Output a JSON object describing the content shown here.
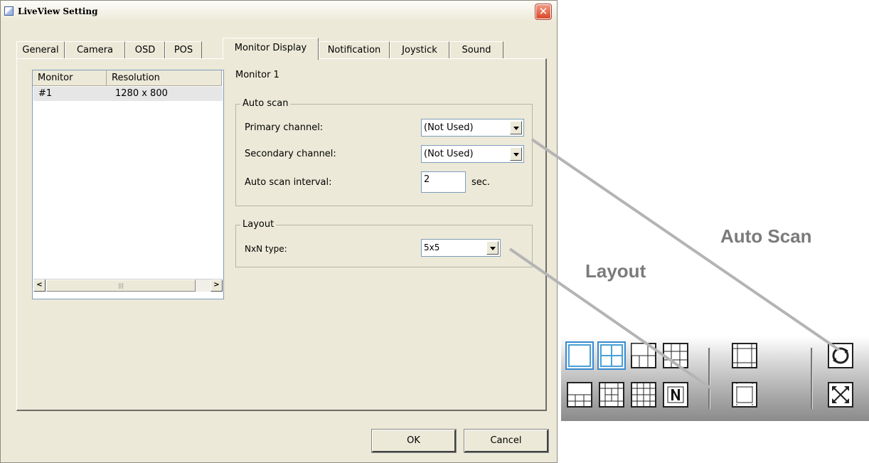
{
  "window": {
    "title": "LiveView Setting"
  },
  "tabs": [
    {
      "label": "General"
    },
    {
      "label": "Camera"
    },
    {
      "label": "OSD"
    },
    {
      "label": "POS"
    },
    {
      "label": "Monitor Display",
      "active": true
    },
    {
      "label": "Notification"
    },
    {
      "label": "Joystick"
    },
    {
      "label": "Sound"
    }
  ],
  "monitor_list": {
    "columns": [
      "Monitor",
      "Resolution"
    ],
    "rows": [
      {
        "monitor": "#1",
        "resolution": "1280 x 800"
      }
    ]
  },
  "monitor_panel": {
    "heading": "Monitor 1",
    "auto_scan": {
      "legend": "Auto scan",
      "primary_label": "Primary channel:",
      "primary_value": "(Not Used)",
      "secondary_label": "Secondary channel:",
      "secondary_value": "(Not Used)",
      "interval_label": "Auto scan interval:",
      "interval_value": "2",
      "interval_unit": "sec."
    },
    "layout": {
      "legend": "Layout",
      "nxn_label": "NxN type:",
      "nxn_value": "5x5"
    }
  },
  "buttons": {
    "ok": "OK",
    "cancel": "Cancel"
  },
  "annotations": {
    "auto_scan": "Auto Scan",
    "layout": "Layout"
  },
  "toolbar": {
    "top_row": [
      "single-view-icon",
      "quad-view-icon",
      "six-view-icon",
      "nine-view-icon",
      "sequence-view-icon",
      "auto-scan-icon"
    ],
    "bottom_row": [
      "twelve-view-icon",
      "thirteen-view-icon",
      "sixteen-view-icon",
      "nxn-layout-icon",
      "full-border-view-icon",
      "fullscreen-icon"
    ]
  },
  "colors": {
    "accent": "#4aa0d8",
    "annotation": "#7b7b7b",
    "close": "#d9472a"
  }
}
